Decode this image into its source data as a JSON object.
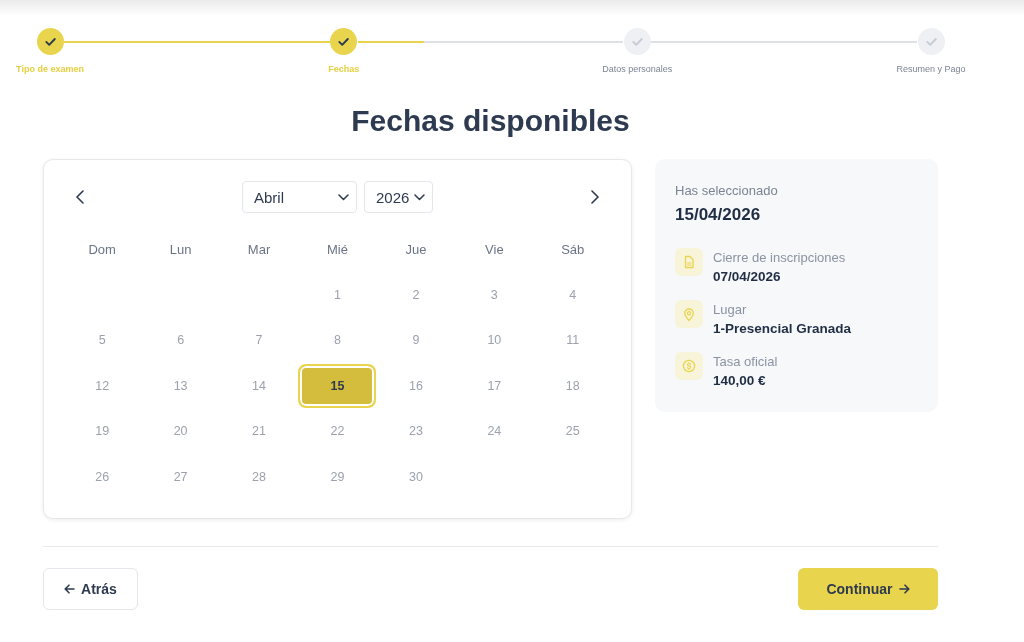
{
  "stepper": {
    "steps": [
      {
        "label": "Tipo de examen",
        "completed": true
      },
      {
        "label": "Fechas",
        "completed": true
      },
      {
        "label": "Datos personales",
        "completed": false
      },
      {
        "label": "Resumen y Pago",
        "completed": false
      }
    ],
    "level": 0.25
  },
  "title": "Fechas disponibles",
  "calendar": {
    "month": "Abril",
    "year": "2026",
    "weekdays": [
      "Dom",
      "Lun",
      "Mar",
      "Mié",
      "Jue",
      "Vie",
      "Sáb"
    ],
    "weeks": [
      {
        "days": [
          {
            "label": "1",
            "selected": false
          },
          {
            "label": "2",
            "selected": false
          },
          {
            "label": "3",
            "selected": false
          },
          {
            "label": "4",
            "selected": false
          }
        ]
      },
      {
        "days": [
          {
            "label": "5",
            "selected": false
          },
          {
            "label": "6",
            "selected": false
          },
          {
            "label": "7",
            "selected": false
          },
          {
            "label": "8",
            "selected": false
          },
          {
            "label": "9",
            "selected": false
          },
          {
            "label": "10",
            "selected": false
          },
          {
            "label": "11",
            "selected": false
          }
        ]
      },
      {
        "days": [
          {
            "label": "12",
            "selected": false
          },
          {
            "label": "13",
            "selected": false
          },
          {
            "label": "14",
            "selected": false
          },
          {
            "label": "15",
            "selected": true
          },
          {
            "label": "16",
            "selected": false
          },
          {
            "label": "17",
            "selected": false
          },
          {
            "label": "18",
            "selected": false
          }
        ]
      },
      {
        "days": [
          {
            "label": "19",
            "selected": false
          },
          {
            "label": "20",
            "selected": false
          },
          {
            "label": "21",
            "selected": false
          },
          {
            "label": "22",
            "selected": false
          },
          {
            "label": "23",
            "selected": false
          },
          {
            "label": "24",
            "selected": false
          },
          {
            "label": "25",
            "selected": false
          }
        ]
      },
      {
        "days": [
          {
            "label": "26",
            "selected": false
          },
          {
            "label": "27",
            "selected": false
          },
          {
            "label": "28",
            "selected": false
          },
          {
            "label": "29",
            "selected": false
          },
          {
            "label": "30",
            "selected": false
          }
        ]
      }
    ]
  },
  "summary": {
    "heading": "Has seleccionado",
    "date": "15/04/2026",
    "items": [
      {
        "kind": "document",
        "label": "Cierre de inscripciones",
        "value": "07/04/2026"
      },
      {
        "kind": "location",
        "label": "Lugar",
        "value": "1-Presencial Granada"
      },
      {
        "kind": "coin",
        "label": "Tasa oficial",
        "value": "140,00 €"
      }
    ]
  },
  "buttons": [
    {
      "kind": "back",
      "label": "Atrás"
    },
    {
      "kind": "next",
      "label": "Continuar"
    }
  ]
}
